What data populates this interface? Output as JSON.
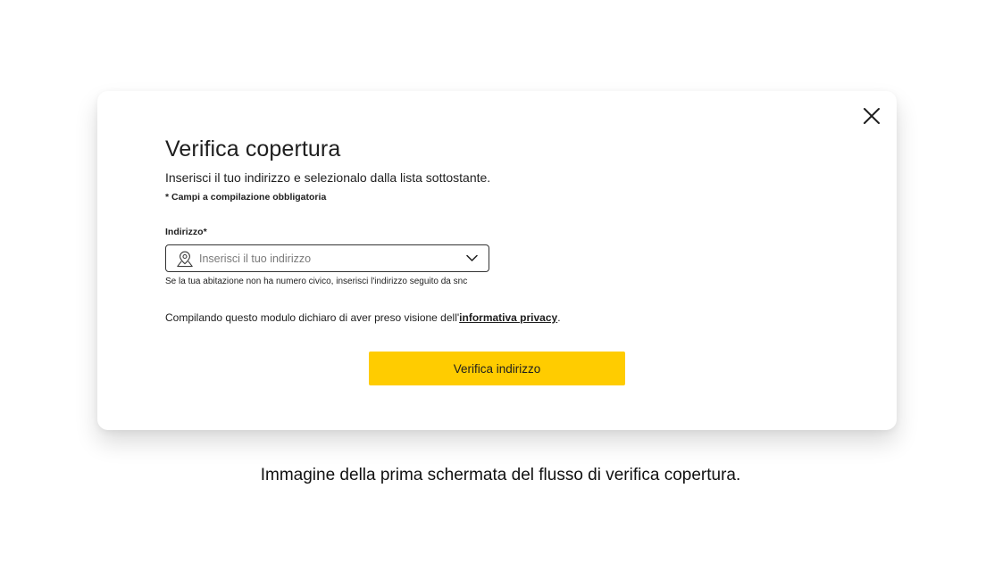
{
  "modal": {
    "title": "Verifica copertura",
    "subtitle": "Inserisci il tuo indirizzo e selezionalo dalla lista sottostante.",
    "required_note": "* Campi a compilazione obbligatoria",
    "address_field": {
      "label": "Indirizzo*",
      "value": "",
      "placeholder": "Inserisci il tuo indirizzo",
      "leading_icon": "location-pin-icon",
      "trailing_icon": "chevron-down-icon"
    },
    "helper_text": "Se la tua abitazione non ha numero civico, inserisci l'indirizzo seguito da snc",
    "privacy_text": "Compilando questo modulo dichiaro di aver preso visione dell'",
    "privacy_link": "informativa privacy",
    "privacy_end": ".",
    "submit_label": "Verifica indirizzo",
    "close_icon": "close-icon"
  },
  "caption": "Immagine della prima schermata del flusso di verifica copertura.",
  "colors": {
    "primary_button": "#ffcc00",
    "text": "#1e1e1e",
    "border": "#333333",
    "placeholder": "#7a7a7a"
  }
}
